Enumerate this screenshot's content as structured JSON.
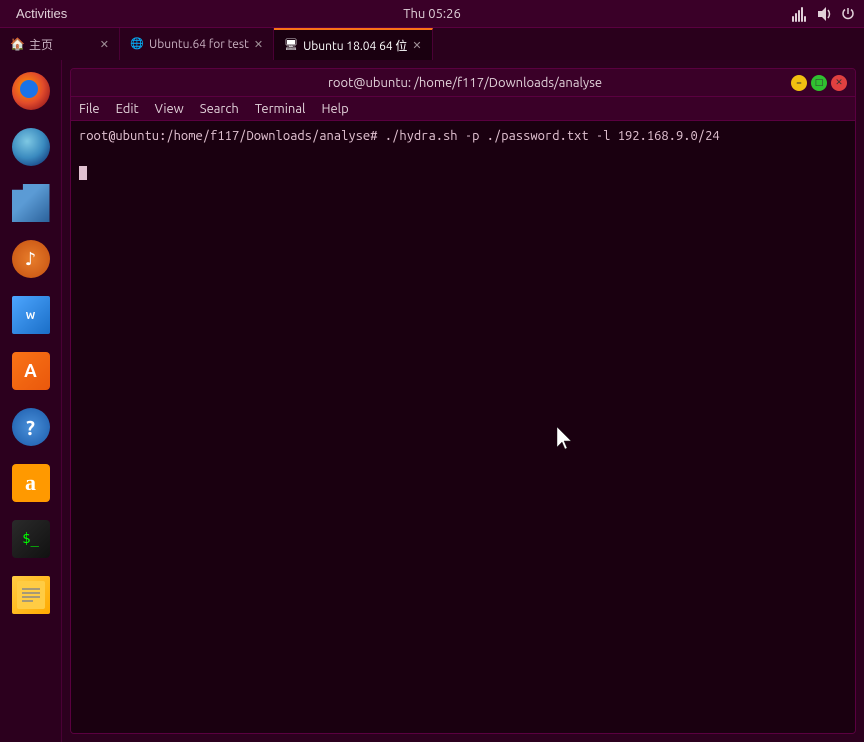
{
  "topbar": {
    "activities_label": "Activities",
    "time": "Thu 05:26"
  },
  "taskbar": {
    "tabs": [
      {
        "id": "home",
        "label": "主页",
        "icon": "home-icon",
        "active": false
      },
      {
        "id": "ubuntu-test",
        "label": "Ubuntu.64 for test",
        "icon": "browser-icon",
        "active": false
      },
      {
        "id": "ubuntu-pos",
        "label": "Ubuntu 18.04 64 位",
        "icon": "terminal-tab-icon",
        "active": true
      }
    ]
  },
  "terminal": {
    "title": "root@ubuntu: /home/f117/Downloads/analyse",
    "menu_items": [
      "File",
      "Edit",
      "View",
      "Search",
      "Terminal",
      "Help"
    ],
    "command_line": "root@ubuntu:/home/f117/Downloads/analyse# ./hydra.sh -p ./password.txt -l 192.168.9.0/24"
  },
  "sidebar": {
    "items": [
      {
        "id": "firefox",
        "label": "Firefox"
      },
      {
        "id": "thunderbird",
        "label": "Thunderbird"
      },
      {
        "id": "files",
        "label": "Files"
      },
      {
        "id": "rhythmbox",
        "label": "Rhythmbox"
      },
      {
        "id": "writer",
        "label": "LibreOffice Writer"
      },
      {
        "id": "appstore",
        "label": "App Store"
      },
      {
        "id": "help",
        "label": "Help"
      },
      {
        "id": "amazon",
        "label": "Amazon"
      },
      {
        "id": "terminal",
        "label": "Terminal"
      },
      {
        "id": "notes",
        "label": "Notes"
      }
    ]
  }
}
